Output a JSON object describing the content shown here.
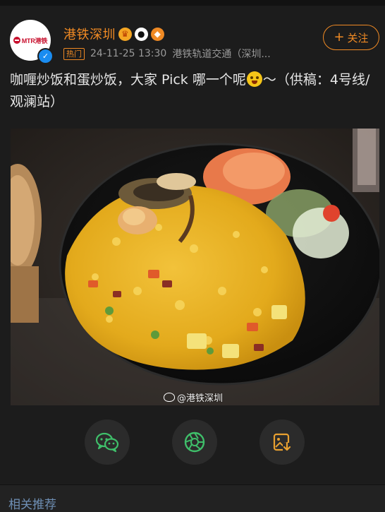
{
  "post": {
    "account": {
      "avatar_logo_text": "MTR港铁",
      "username": "港铁深圳",
      "badges": [
        "crown-badge",
        "panda-badge",
        "fox-badge"
      ]
    },
    "meta": {
      "tag": "热门",
      "timestamp": "24-11-25 13:30",
      "source": "港铁轨道交通（深圳..."
    },
    "follow_label": "关注",
    "text_before_emoji": "咖喱炒饭和蛋炒饭，大家 Pick 哪一个呢",
    "text_after_emoji": "～（供稿：4号线/观澜站）",
    "image": {
      "watermark": "@港铁深圳"
    },
    "actions": [
      "wechat-share",
      "moments-share",
      "save-image"
    ]
  },
  "related": {
    "title": "相关推荐"
  },
  "colors": {
    "accent": "#f08a24",
    "background": "#1c1c1c",
    "verified": "#1a8cf0",
    "related_link": "#6e8fb4"
  }
}
